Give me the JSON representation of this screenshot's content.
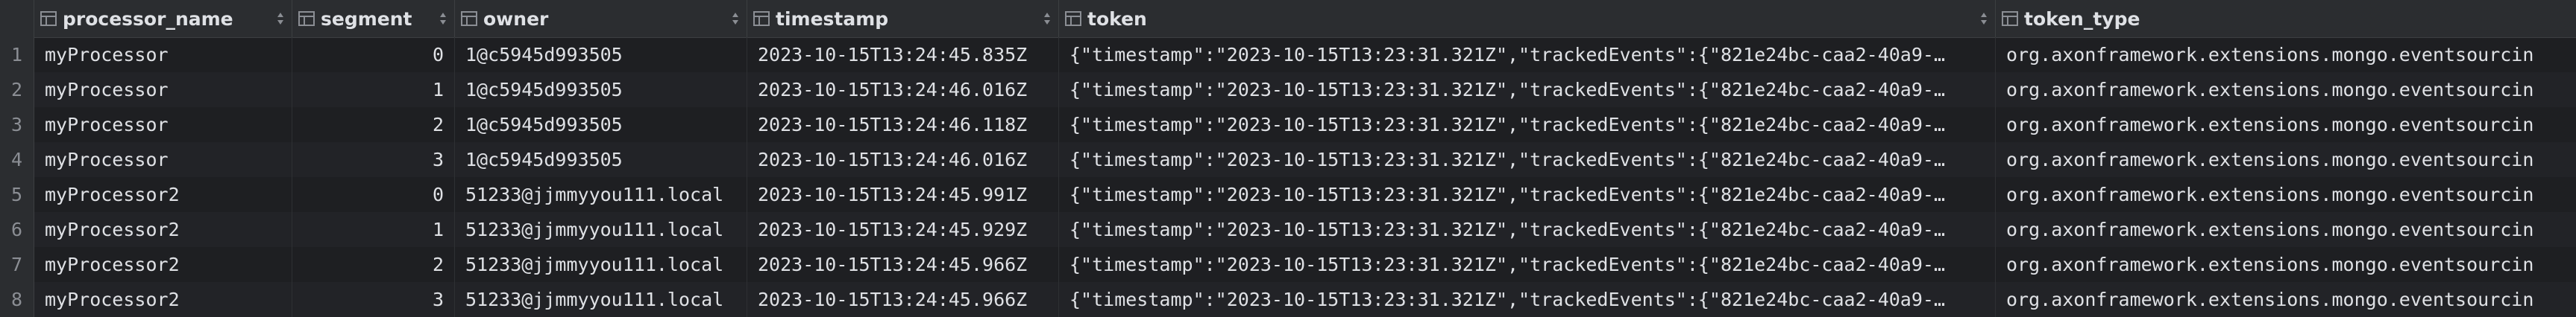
{
  "columns": [
    {
      "label": "processor_name"
    },
    {
      "label": "segment"
    },
    {
      "label": "owner"
    },
    {
      "label": "timestamp"
    },
    {
      "label": "token"
    },
    {
      "label": "token_type"
    }
  ],
  "rows": [
    {
      "num": "1",
      "processor_name": "myProcessor",
      "segment": "0",
      "owner": "1@c5945d993505",
      "timestamp": "2023-10-15T13:24:45.835Z",
      "token": "{\"timestamp\":\"2023-10-15T13:23:31.321Z\",\"trackedEvents\":{\"821e24bc-caa2-40a9-…",
      "token_type": "org.axonframework.extensions.mongo.eventsourcin"
    },
    {
      "num": "2",
      "processor_name": "myProcessor",
      "segment": "1",
      "owner": "1@c5945d993505",
      "timestamp": "2023-10-15T13:24:46.016Z",
      "token": "{\"timestamp\":\"2023-10-15T13:23:31.321Z\",\"trackedEvents\":{\"821e24bc-caa2-40a9-…",
      "token_type": "org.axonframework.extensions.mongo.eventsourcin"
    },
    {
      "num": "3",
      "processor_name": "myProcessor",
      "segment": "2",
      "owner": "1@c5945d993505",
      "timestamp": "2023-10-15T13:24:46.118Z",
      "token": "{\"timestamp\":\"2023-10-15T13:23:31.321Z\",\"trackedEvents\":{\"821e24bc-caa2-40a9-…",
      "token_type": "org.axonframework.extensions.mongo.eventsourcin"
    },
    {
      "num": "4",
      "processor_name": "myProcessor",
      "segment": "3",
      "owner": "1@c5945d993505",
      "timestamp": "2023-10-15T13:24:46.016Z",
      "token": "{\"timestamp\":\"2023-10-15T13:23:31.321Z\",\"trackedEvents\":{\"821e24bc-caa2-40a9-…",
      "token_type": "org.axonframework.extensions.mongo.eventsourcin"
    },
    {
      "num": "5",
      "processor_name": "myProcessor2",
      "segment": "0",
      "owner": "51233@jjmmyyou111.local",
      "timestamp": "2023-10-15T13:24:45.991Z",
      "token": "{\"timestamp\":\"2023-10-15T13:23:31.321Z\",\"trackedEvents\":{\"821e24bc-caa2-40a9-…",
      "token_type": "org.axonframework.extensions.mongo.eventsourcin"
    },
    {
      "num": "6",
      "processor_name": "myProcessor2",
      "segment": "1",
      "owner": "51233@jjmmyyou111.local",
      "timestamp": "2023-10-15T13:24:45.929Z",
      "token": "{\"timestamp\":\"2023-10-15T13:23:31.321Z\",\"trackedEvents\":{\"821e24bc-caa2-40a9-…",
      "token_type": "org.axonframework.extensions.mongo.eventsourcin"
    },
    {
      "num": "7",
      "processor_name": "myProcessor2",
      "segment": "2",
      "owner": "51233@jjmmyyou111.local",
      "timestamp": "2023-10-15T13:24:45.966Z",
      "token": "{\"timestamp\":\"2023-10-15T13:23:31.321Z\",\"trackedEvents\":{\"821e24bc-caa2-40a9-…",
      "token_type": "org.axonframework.extensions.mongo.eventsourcin"
    },
    {
      "num": "8",
      "processor_name": "myProcessor2",
      "segment": "3",
      "owner": "51233@jjmmyyou111.local",
      "timestamp": "2023-10-15T13:24:45.966Z",
      "token": "{\"timestamp\":\"2023-10-15T13:23:31.321Z\",\"trackedEvents\":{\"821e24bc-caa2-40a9-…",
      "token_type": "org.axonframework.extensions.mongo.eventsourcin"
    }
  ],
  "icons": {
    "column": "table-column-icon",
    "sort": "sort-arrows-icon"
  }
}
